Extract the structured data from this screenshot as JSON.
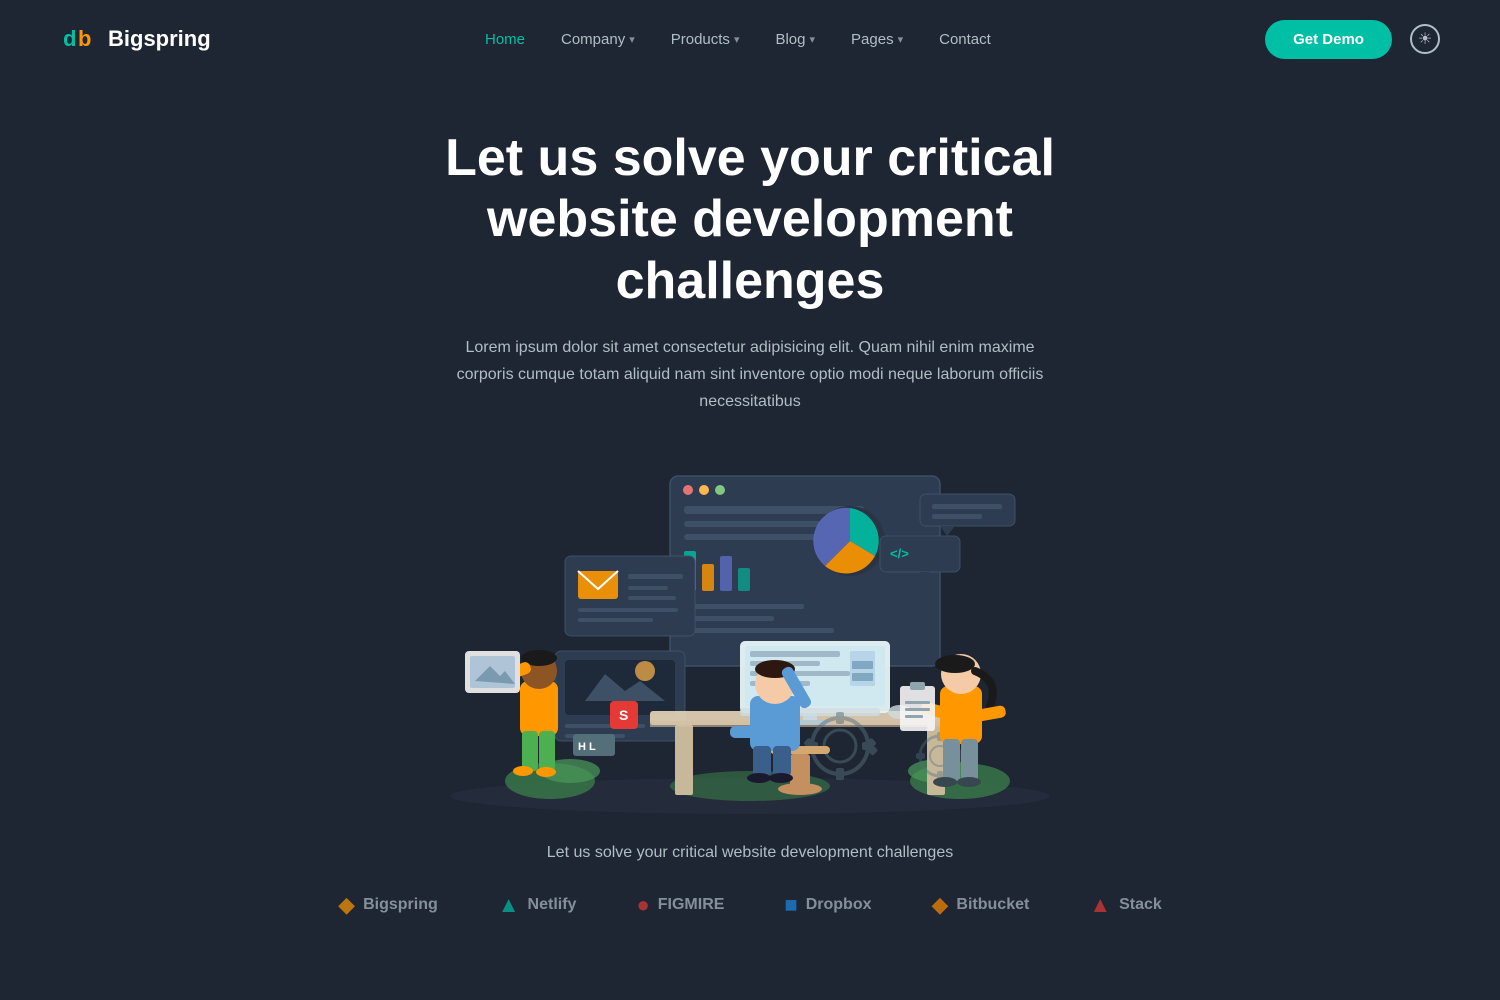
{
  "navbar": {
    "logo_text": "Bigspring",
    "links": [
      {
        "label": "Home",
        "active": true,
        "has_dropdown": false
      },
      {
        "label": "Company",
        "active": false,
        "has_dropdown": true
      },
      {
        "label": "Products",
        "active": false,
        "has_dropdown": true
      },
      {
        "label": "Blog",
        "active": false,
        "has_dropdown": true
      },
      {
        "label": "Pages",
        "active": false,
        "has_dropdown": true
      },
      {
        "label": "Contact",
        "active": false,
        "has_dropdown": false
      }
    ],
    "cta_label": "Get Demo",
    "theme_icon": "☀"
  },
  "hero": {
    "heading": "Let us solve your critical website development challenges",
    "subtext": "Lorem ipsum dolor sit amet consectetur adipisicing elit. Quam nihil enim maxime corporis cumque totam aliquid nam sint inventore optio modi neque laborum officiis necessitatibus"
  },
  "bottom": {
    "tagline": "Let us solve your critical website development challenges",
    "logos": [
      {
        "name": "Bigspring",
        "color": "#ff9800"
      },
      {
        "name": "Netlify",
        "color": "#00bfa5"
      },
      {
        "name": "FIGMIRE",
        "color": "#e53935"
      },
      {
        "name": "Dropbox",
        "color": "#1e88e5"
      },
      {
        "name": "Bitbucket",
        "color": "#fb8c00"
      },
      {
        "name": "Stack",
        "color": "#e53935"
      }
    ]
  }
}
